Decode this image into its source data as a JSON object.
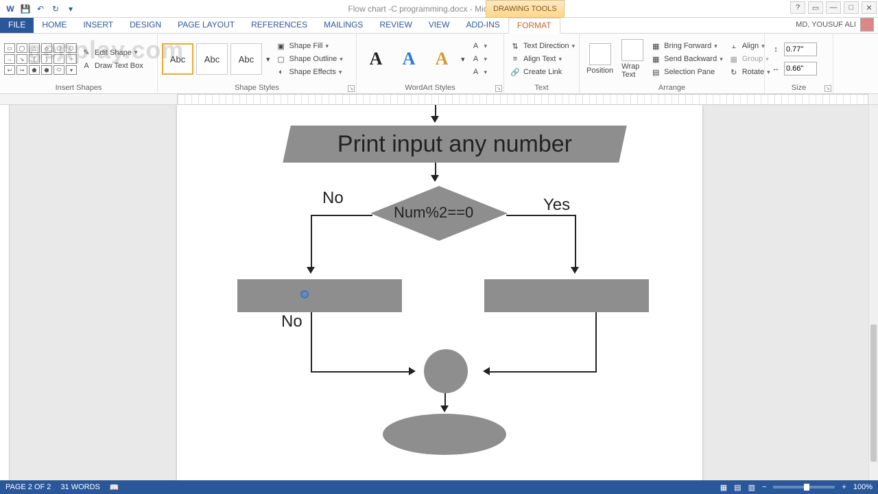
{
  "title": "Flow chart -C programming.docx - Microsoft Word",
  "context_tab_group": "DRAWING TOOLS",
  "user_name": "MD, YOUSUF ALI",
  "tabs": {
    "file": "FILE",
    "home": "HOME",
    "insert": "INSERT",
    "design": "DESIGN",
    "page_layout": "PAGE LAYOUT",
    "references": "REFERENCES",
    "mailings": "MAILINGS",
    "review": "REVIEW",
    "view": "VIEW",
    "add_ins": "ADD-INS",
    "format": "FORMAT"
  },
  "ribbon": {
    "insert_shapes": {
      "label": "Insert Shapes",
      "edit_shape": "Edit Shape",
      "draw_text_box": "Draw Text Box"
    },
    "shape_styles": {
      "label": "Shape Styles",
      "swatch_text": "Abc",
      "fill": "Shape Fill",
      "outline": "Shape Outline",
      "effects": "Shape Effects"
    },
    "wordart": {
      "label": "WordArt Styles",
      "glyph": "A"
    },
    "text": {
      "label": "Text",
      "direction": "Text Direction",
      "align": "Align Text",
      "create_link": "Create Link"
    },
    "arrange": {
      "label": "Arrange",
      "position": "Position",
      "wrap": "Wrap Text",
      "forward": "Bring Forward",
      "backward": "Send Backward",
      "selection": "Selection Pane",
      "align_btn": "Align",
      "group": "Group",
      "rotate": "Rotate"
    },
    "size": {
      "label": "Size",
      "height": "0.77\"",
      "width": "0.66\""
    }
  },
  "flowchart": {
    "top_box": "Print input any number",
    "decision": "Num%2==0",
    "no": "No",
    "yes": "Yes",
    "no2": "No"
  },
  "status": {
    "page": "PAGE 2 OF 2",
    "words": "31 WORDS",
    "zoom": "100%"
  },
  "watermark": "genplay.com"
}
